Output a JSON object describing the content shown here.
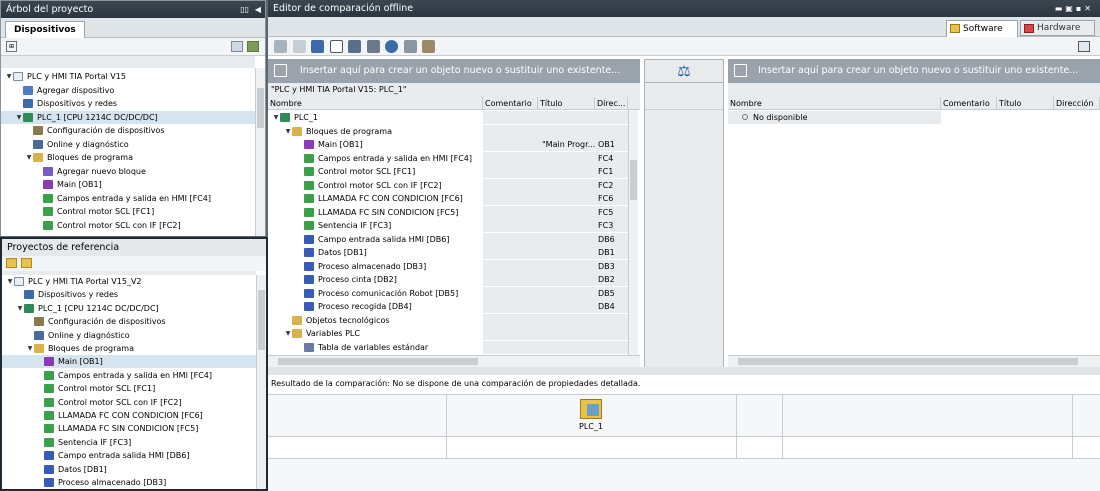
{
  "left_panel": {
    "title": "Árbol del proyecto",
    "tab": "Dispositivos",
    "tree": [
      {
        "label": "PLC y HMI TIA Portal V15",
        "level": 0,
        "icon": "project-icon",
        "color": "#e8eef4"
      },
      {
        "label": "Agregar dispositivo",
        "level": 1,
        "icon": "add-device-icon",
        "color": "#4d7cc4"
      },
      {
        "label": "Dispositivos y redes",
        "level": 1,
        "icon": "network-icon",
        "color": "#3d6aa8"
      },
      {
        "label": "PLC_1 [CPU 1214C DC/DC/DC]",
        "level": 1,
        "icon": "plc-icon",
        "color": "#2e8b57",
        "selected": true
      },
      {
        "label": "Configuración de dispositivos",
        "level": 2,
        "icon": "device-config-icon",
        "color": "#8a7a4a"
      },
      {
        "label": "Online y diagnóstico",
        "level": 2,
        "icon": "diagnostic-icon",
        "color": "#4a6a9a"
      },
      {
        "label": "Bloques de programa",
        "level": 2,
        "icon": "folder-icon",
        "color": "#d9b24c"
      },
      {
        "label": "Agregar nuevo bloque",
        "level": 3,
        "icon": "add-block-icon",
        "color": "#7a5ac8"
      },
      {
        "label": "Main [OB1]",
        "level": 3,
        "icon": "ob-icon",
        "color": "#8a3ab8"
      },
      {
        "label": "Campos entrada y salida en HMI [FC4]",
        "level": 3,
        "icon": "fc-icon",
        "color": "#3aa14a"
      },
      {
        "label": "Control motor SCL [FC1]",
        "level": 3,
        "icon": "fc-icon",
        "color": "#3aa14a"
      },
      {
        "label": "Control motor SCL con IF [FC2]",
        "level": 3,
        "icon": "fc-icon",
        "color": "#3aa14a"
      }
    ],
    "ref_title": "Proyectos de referencia",
    "ref_tree": [
      {
        "label": "PLC y HMI TIA Portal V15_V2",
        "level": 0,
        "icon": "project-icon",
        "color": "#e8eef4"
      },
      {
        "label": "Dispositivos y redes",
        "level": 1,
        "icon": "network-icon",
        "color": "#3d6aa8"
      },
      {
        "label": "PLC_1 [CPU 1214C DC/DC/DC]",
        "level": 1,
        "icon": "plc-icon",
        "color": "#2e8b57"
      },
      {
        "label": "Configuración de dispositivos",
        "level": 2,
        "icon": "device-config-icon",
        "color": "#8a7a4a"
      },
      {
        "label": "Online y diagnóstico",
        "level": 2,
        "icon": "diagnostic-icon",
        "color": "#4a6a9a"
      },
      {
        "label": "Bloques de programa",
        "level": 2,
        "icon": "folder-icon",
        "color": "#d9b24c"
      },
      {
        "label": "Main [OB1]",
        "level": 3,
        "icon": "ob-icon",
        "color": "#8a3ab8",
        "selected": true
      },
      {
        "label": "Campos entrada y salida en HMI [FC4]",
        "level": 3,
        "icon": "fc-icon",
        "color": "#3aa14a"
      },
      {
        "label": "Control motor SCL [FC1]",
        "level": 3,
        "icon": "fc-icon",
        "color": "#3aa14a"
      },
      {
        "label": "Control motor SCL con IF [FC2]",
        "level": 3,
        "icon": "fc-icon",
        "color": "#3aa14a"
      },
      {
        "label": "LLAMADA FC CON CONDICION [FC6]",
        "level": 3,
        "icon": "fc-icon",
        "color": "#3aa14a"
      },
      {
        "label": "LLAMADA FC SIN CONDICION [FC5]",
        "level": 3,
        "icon": "fc-icon",
        "color": "#3aa14a"
      },
      {
        "label": "Sentencia IF [FC3]",
        "level": 3,
        "icon": "fc-icon",
        "color": "#3aa14a"
      },
      {
        "label": "Campo entrada salida HMI [DB6]",
        "level": 3,
        "icon": "db-icon",
        "color": "#3a5ab8"
      },
      {
        "label": "Datos [DB1]",
        "level": 3,
        "icon": "db-icon",
        "color": "#3a5ab8"
      },
      {
        "label": "Proceso almacenado [DB3]",
        "level": 3,
        "icon": "db-icon",
        "color": "#3a5ab8"
      }
    ]
  },
  "editor": {
    "title": "Editor de comparación offline",
    "tab_software": "Software",
    "tab_hardware": "Hardware",
    "insert_hint_left": "Insertar aquí para crear un objeto nuevo o sustituir uno existente...",
    "insert_hint_right": "Insertar aquí para crear un objeto nuevo o sustituir uno existente...",
    "left_path": "\"PLC y HMI TIA Portal V15: PLC_1\"",
    "columns_left": {
      "name": "Nombre",
      "comment": "Comentario",
      "title": "Título",
      "dir": "Direc..."
    },
    "columns_right": {
      "name": "Nombre",
      "comment": "Comentario",
      "title": "Título",
      "dir": "Dirección"
    },
    "rows": [
      {
        "label": "PLC_1",
        "level": 0,
        "title": "",
        "addr": "",
        "icon": "plc-icon",
        "color": "#2e8b57"
      },
      {
        "label": "Bloques de programa",
        "level": 1,
        "title": "",
        "addr": "",
        "icon": "folder-icon",
        "color": "#d9b24c"
      },
      {
        "label": "Main [OB1]",
        "level": 2,
        "title": "\"Main Progr...",
        "addr": "OB1",
        "icon": "ob-icon",
        "color": "#8a3ab8"
      },
      {
        "label": "Campos entrada y salida en HMI [FC4]",
        "level": 2,
        "title": "",
        "addr": "FC4",
        "icon": "fc-icon",
        "color": "#3aa14a"
      },
      {
        "label": "Control motor SCL [FC1]",
        "level": 2,
        "title": "",
        "addr": "FC1",
        "icon": "fc-icon",
        "color": "#3aa14a"
      },
      {
        "label": "Control motor SCL con IF [FC2]",
        "level": 2,
        "title": "",
        "addr": "FC2",
        "icon": "fc-icon",
        "color": "#3aa14a"
      },
      {
        "label": "LLAMADA FC CON CONDICION [FC6]",
        "level": 2,
        "title": "",
        "addr": "FC6",
        "icon": "fc-icon",
        "color": "#3aa14a"
      },
      {
        "label": "LLAMADA FC SIN CONDICION [FC5]",
        "level": 2,
        "title": "",
        "addr": "FC5",
        "icon": "fc-icon",
        "color": "#3aa14a"
      },
      {
        "label": "Sentencia IF [FC3]",
        "level": 2,
        "title": "",
        "addr": "FC3",
        "icon": "fc-icon",
        "color": "#3aa14a"
      },
      {
        "label": "Campo entrada salida HMI [DB6]",
        "level": 2,
        "title": "",
        "addr": "DB6",
        "icon": "db-icon",
        "color": "#3a5ab8"
      },
      {
        "label": "Datos [DB1]",
        "level": 2,
        "title": "",
        "addr": "DB1",
        "icon": "db-icon",
        "color": "#3a5ab8"
      },
      {
        "label": "Proceso almacenado [DB3]",
        "level": 2,
        "title": "",
        "addr": "DB3",
        "icon": "db-icon",
        "color": "#3a5ab8"
      },
      {
        "label": "Proceso cinta [DB2]",
        "level": 2,
        "title": "",
        "addr": "DB2",
        "icon": "db-icon",
        "color": "#3a5ab8"
      },
      {
        "label": "Proceso comunicación Robot [DB5]",
        "level": 2,
        "title": "",
        "addr": "DB5",
        "icon": "db-icon",
        "color": "#3a5ab8"
      },
      {
        "label": "Proceso recogida [DB4]",
        "level": 2,
        "title": "",
        "addr": "DB4",
        "icon": "db-icon",
        "color": "#3a5ab8"
      },
      {
        "label": "Objetos tecnológicos",
        "level": 1,
        "title": "",
        "addr": "",
        "icon": "folder-icon",
        "color": "#d9b24c"
      },
      {
        "label": "Variables PLC",
        "level": 1,
        "title": "",
        "addr": "",
        "icon": "folder-icon",
        "color": "#d9b24c"
      },
      {
        "label": "Tabla de variables estándar",
        "level": 2,
        "title": "",
        "addr": "",
        "icon": "table-icon",
        "color": "#6a7aa8"
      }
    ],
    "right_status": "No disponible",
    "result_text": "Resultado de la comparación: No se dispone de una comparación de propiedades detallada.",
    "result_item": "PLC_1"
  }
}
